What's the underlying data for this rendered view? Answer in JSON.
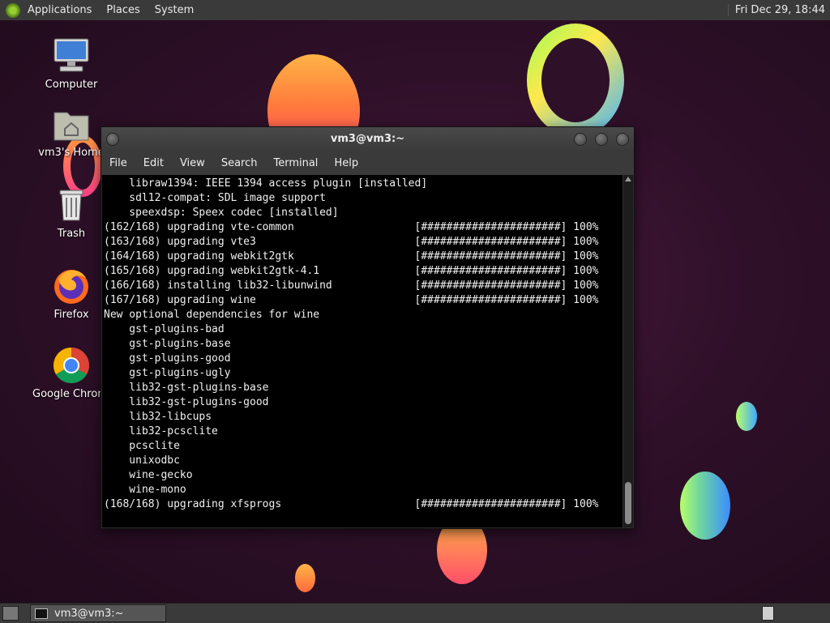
{
  "top_panel": {
    "menus": [
      "Applications",
      "Places",
      "System"
    ],
    "clock": "Fri Dec 29, 18:44"
  },
  "desktop_icons": [
    {
      "label": "Computer",
      "icon": "computer-icon"
    },
    {
      "label": "vm3's Home",
      "icon": "home-folder-icon"
    },
    {
      "label": "Trash",
      "icon": "trash-icon"
    },
    {
      "label": "Firefox",
      "icon": "firefox-icon"
    },
    {
      "label": "Google Chrome",
      "icon": "chrome-icon"
    }
  ],
  "terminal": {
    "title": "vm3@vm3:~",
    "menu": [
      "File",
      "Edit",
      "View",
      "Search",
      "Terminal",
      "Help"
    ],
    "lines": [
      "    libraw1394: IEEE 1394 access plugin [installed]",
      "    sdl12-compat: SDL image support",
      "    speexdsp: Speex codec [installed]",
      "(162/168) upgrading vte-common                   [######################] 100%",
      "(163/168) upgrading vte3                         [######################] 100%",
      "(164/168) upgrading webkit2gtk                   [######################] 100%",
      "(165/168) upgrading webkit2gtk-4.1               [######################] 100%",
      "(166/168) installing lib32-libunwind             [######################] 100%",
      "(167/168) upgrading wine                         [######################] 100%",
      "New optional dependencies for wine",
      "    gst-plugins-bad",
      "    gst-plugins-base",
      "    gst-plugins-good",
      "    gst-plugins-ugly",
      "    lib32-gst-plugins-base",
      "    lib32-gst-plugins-good",
      "    lib32-libcups",
      "    lib32-pcsclite",
      "    pcsclite",
      "    unixodbc",
      "    wine-gecko",
      "    wine-mono",
      "(168/168) upgrading xfsprogs                     [######################] 100%"
    ]
  },
  "taskbar": {
    "task_label": "vm3@vm3:~"
  }
}
